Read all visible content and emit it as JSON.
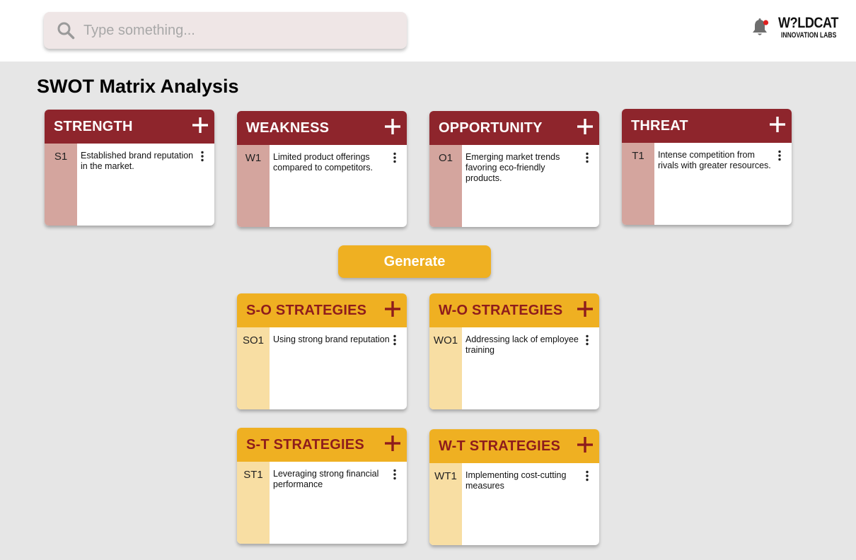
{
  "search": {
    "placeholder": "Type something..."
  },
  "logo": {
    "title": "W?LDCAT",
    "subtitle": "INNOVATION LABS"
  },
  "page": {
    "title": "SWOT Matrix Analysis"
  },
  "swot": {
    "strength": {
      "title": "STRENGTH",
      "items": [
        {
          "code": "S1",
          "text": "Established brand reputation in the market."
        }
      ]
    },
    "weakness": {
      "title": "WEAKNESS",
      "items": [
        {
          "code": "W1",
          "text": "Limited product offerings compared to competitors."
        }
      ]
    },
    "opportunity": {
      "title": "OPPORTUNITY",
      "items": [
        {
          "code": "O1",
          "text": "Emerging market trends favoring eco-friendly products."
        }
      ]
    },
    "threat": {
      "title": "THREAT",
      "items": [
        {
          "code": "T1",
          "text": "Intense competition from rivals with greater resources."
        }
      ]
    }
  },
  "generate_label": "Generate",
  "strategies": {
    "so": {
      "title": "S-O STRATEGIES",
      "items": [
        {
          "code": "SO1",
          "text": "Using strong brand reputation"
        }
      ]
    },
    "wo": {
      "title": "W-O STRATEGIES",
      "items": [
        {
          "code": "WO1",
          "text": "Addressing lack of employee training"
        }
      ]
    },
    "st": {
      "title": "S-T STRATEGIES",
      "items": [
        {
          "code": "ST1",
          "text": "Leveraging strong financial performance"
        }
      ]
    },
    "wt": {
      "title": "W-T STRATEGIES",
      "items": [
        {
          "code": "WT1",
          "text": "Implementing cost-cutting measures"
        }
      ]
    }
  },
  "colors": {
    "swot_header": "#8e252c",
    "swot_code_column": "#d4a59e",
    "strategy_header": "#efb022",
    "strategy_header_text": "#8e1c1c",
    "strategy_code_column": "#f8dea3",
    "notification_dot": "#e02020"
  },
  "icons": {
    "search": "search-icon",
    "bell": "bell-icon",
    "add": "plus-icon",
    "menu": "kebab-menu-icon"
  }
}
